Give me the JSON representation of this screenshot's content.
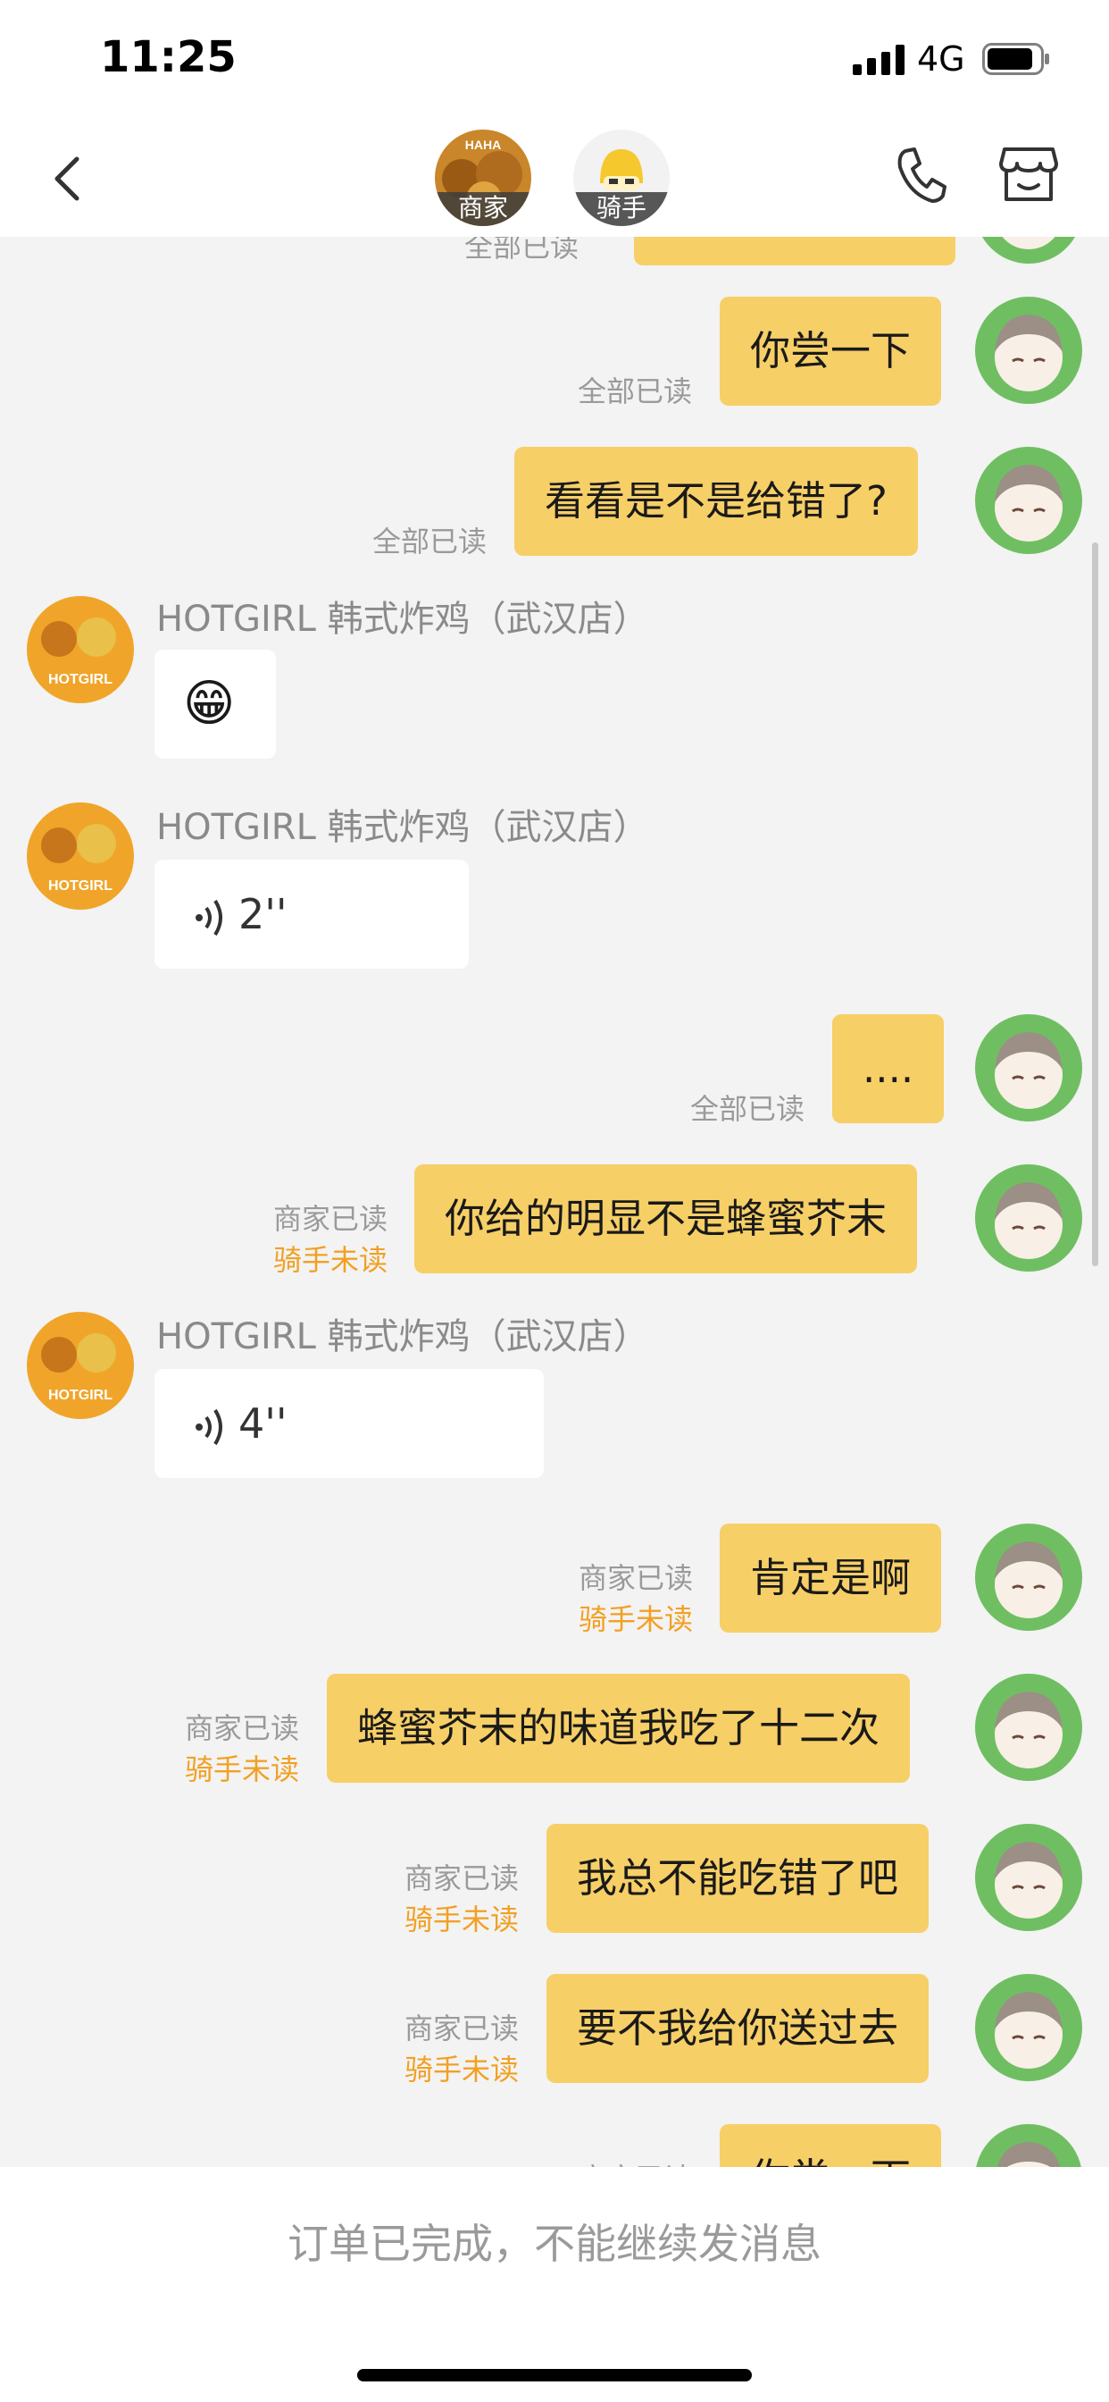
{
  "status_bar": {
    "time": "11:25",
    "network": "4G"
  },
  "nav": {
    "merchant_label": "商家",
    "rider_label": "骑手"
  },
  "shop_name": "HOTGIRL 韩式炸鸡（武汉店）",
  "messages": [
    {
      "text": "你尝一下",
      "status": "全部已读"
    },
    {
      "text": "看看是不是给错了?",
      "status": "全部已读"
    },
    {
      "emoji": "😁"
    },
    {
      "voice": "2''"
    },
    {
      "text": "....",
      "status": "全部已读"
    },
    {
      "text": "你给的明显不是蜂蜜芥末",
      "merchant_status": "商家已读",
      "rider_status": "骑手未读"
    },
    {
      "voice": "4''"
    },
    {
      "text": "肯定是啊",
      "merchant_status": "商家已读",
      "rider_status": "骑手未读"
    },
    {
      "text": "蜂蜜芥末的味道我吃了十二次",
      "merchant_status": "商家已读",
      "rider_status": "骑手未读"
    },
    {
      "text": "我总不能吃错了吧",
      "merchant_status": "商家已读",
      "rider_status": "骑手未读"
    },
    {
      "text": "要不我给你送过去",
      "merchant_status": "商家已读",
      "rider_status": "骑手未读"
    },
    {
      "text": "你尝一下",
      "merchant_status": "商家已读"
    }
  ],
  "partial_top": {
    "status": "全部已读"
  },
  "footer": {
    "notice": "订单已完成，不能继续发消息"
  },
  "colors": {
    "bubble_me": "#f7cf67",
    "unread": "#f2a024"
  }
}
